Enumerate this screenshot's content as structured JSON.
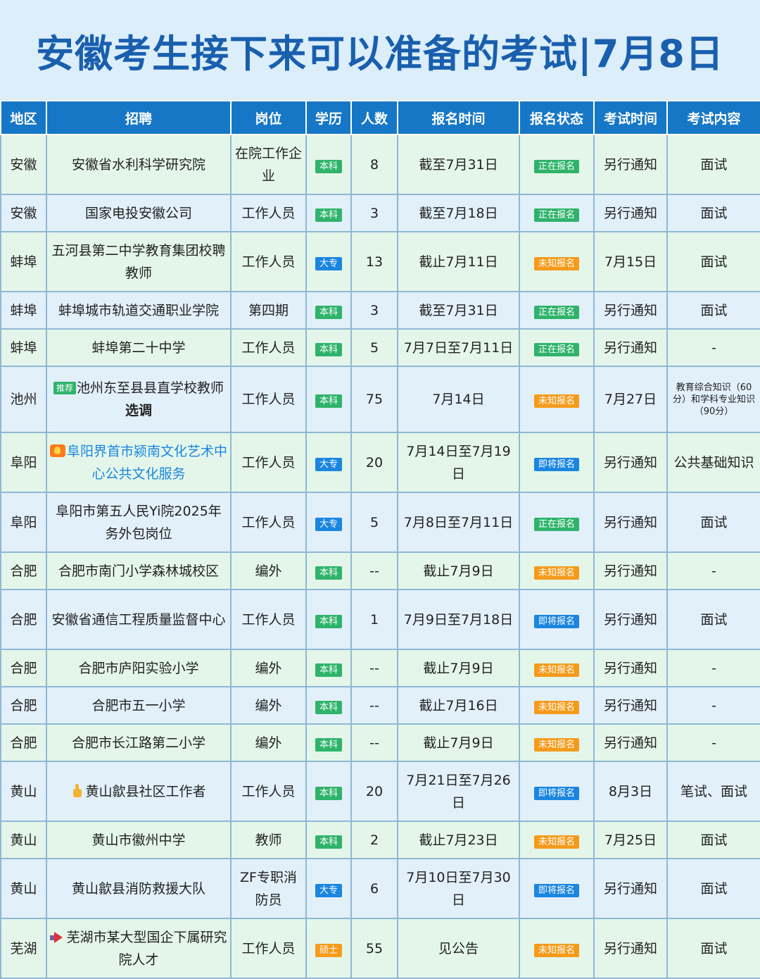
{
  "title": "安徽考生接下来可以准备的考试|7月8日",
  "headers": [
    "地区",
    "招聘",
    "岗位",
    "学历",
    "人数",
    "报名时间",
    "报名状态",
    "考试时间",
    "考试内容"
  ],
  "rows": [
    {
      "region": "安徽",
      "recruit": "安徽省水利科学研究院",
      "post": "在院工作企业",
      "edu": "本科",
      "count": "8",
      "reg_time": "截至7月31日",
      "status": "正在报名",
      "exam_time": "另行通知",
      "content": "面试"
    },
    {
      "region": "安徽",
      "recruit": "国家电投安徽公司",
      "post": "工作人员",
      "edu": "本科",
      "count": "3",
      "reg_time": "截至7月18日",
      "status": "正在报名",
      "exam_time": "另行通知",
      "content": "面试"
    },
    {
      "region": "蚌埠",
      "recruit": "五河县第二中学教育集团校聘教师",
      "post": "工作人员",
      "edu": "大专",
      "count": "13",
      "reg_time": "截止7月11日",
      "status": "未知报名",
      "exam_time": "7月15日",
      "content": "面试"
    },
    {
      "region": "蚌埠",
      "recruit": "蚌埠城市轨道交通职业学院",
      "post": "第四期",
      "edu": "本科",
      "count": "3",
      "reg_time": "截至7月31日",
      "status": "正在报名",
      "exam_time": "另行通知",
      "content": "面试"
    },
    {
      "region": "蚌埠",
      "recruit": "蚌埠第二十中学",
      "post": "工作人员",
      "edu": "本科",
      "count": "5",
      "reg_time": "7月7日至7月11日",
      "status": "正在报名",
      "exam_time": "另行通知",
      "content": "-"
    },
    {
      "region": "池州",
      "recruit_tag": "推荐",
      "recruit": "池州东至县县直学校教师",
      "recruit_tail": "选调",
      "post": "工作人员",
      "edu": "本科",
      "count": "75",
      "reg_time": "7月14日",
      "status": "未知报名",
      "exam_time": "7月27日",
      "content": "教育综合知识（60分）和学科专业知识（90分）"
    },
    {
      "region": "阜阳",
      "recruit": "阜阳界首市颍南文化艺术中心公共文化服务",
      "post": "工作人员",
      "edu": "大专",
      "count": "20",
      "reg_time": "7月14日至7月19日",
      "status": "即将报名",
      "exam_time": "另行通知",
      "content": "公共基础知识"
    },
    {
      "region": "阜阳",
      "recruit": "阜阳市第五人民Yi院2025年务外包岗位",
      "post": "工作人员",
      "edu": "大专",
      "count": "5",
      "reg_time": "7月8日至7月11日",
      "status": "正在报名",
      "exam_time": "另行通知",
      "content": "面试"
    },
    {
      "region": "合肥",
      "recruit": "合肥市南门小学森林城校区",
      "post": "编外",
      "edu": "本科",
      "count": "--",
      "reg_time": "截止7月9日",
      "status": "未知报名",
      "exam_time": "另行通知",
      "content": "-"
    },
    {
      "region": "合肥",
      "recruit": "安徽省通信工程质量监督中心",
      "post": "工作人员",
      "edu": "本科",
      "count": "1",
      "reg_time": "7月9日至7月18日",
      "status": "即将报名",
      "exam_time": "另行通知",
      "content": "面试"
    },
    {
      "region": "合肥",
      "recruit": "合肥市庐阳实验小学",
      "post": "编外",
      "edu": "本科",
      "count": "--",
      "reg_time": "截止7月9日",
      "status": "未知报名",
      "exam_time": "另行通知",
      "content": "-"
    },
    {
      "region": "合肥",
      "recruit": "合肥市五一小学",
      "post": "编外",
      "edu": "本科",
      "count": "--",
      "reg_time": "截止7月16日",
      "status": "未知报名",
      "exam_time": "另行通知",
      "content": "-"
    },
    {
      "region": "合肥",
      "recruit": "合肥市长江路第二小学",
      "post": "编外",
      "edu": "本科",
      "count": "--",
      "reg_time": "截止7月9日",
      "status": "未知报名",
      "exam_time": "另行通知",
      "content": "-"
    },
    {
      "region": "黄山",
      "recruit": "黄山歙县社区工作者",
      "post": "工作人员",
      "edu": "本科",
      "count": "20",
      "reg_time": "7月21日至7月26日",
      "status": "即将报名",
      "exam_time": "8月3日",
      "content": "笔试、面试"
    },
    {
      "region": "黄山",
      "recruit": "黄山市徽州中学",
      "post": "教师",
      "edu": "本科",
      "count": "2",
      "reg_time": "截止7月23日",
      "status": "未知报名",
      "exam_time": "7月25日",
      "content": "面试"
    },
    {
      "region": "黄山",
      "recruit": "黄山歙县消防救援大队",
      "post": "ZF专职消防员",
      "edu": "大专",
      "count": "6",
      "reg_time": "7月10日至7月30日",
      "status": "即将报名",
      "exam_time": "另行通知",
      "content": "面试"
    },
    {
      "region": "芜湖",
      "recruit": "芜湖市某大型国企下属研究院人才",
      "post": "工作人员",
      "edu": "硕士",
      "count": "55",
      "reg_time": "见公告",
      "status": "未知报名",
      "exam_time": "另行通知",
      "content": "面试"
    }
  ],
  "badge_colors": {
    "本科": "#2fb36b",
    "大专": "#1a86e0",
    "硕士": "#f59b1b",
    "正在报名": "#2fb36b",
    "未知报名": "#f59b1b",
    "即将报名": "#1a86e0"
  },
  "icons": {
    "row5": "recommend-tag",
    "row6": "fire-icon",
    "row13": "thumb-icon",
    "row16": "megaphone-icon"
  }
}
